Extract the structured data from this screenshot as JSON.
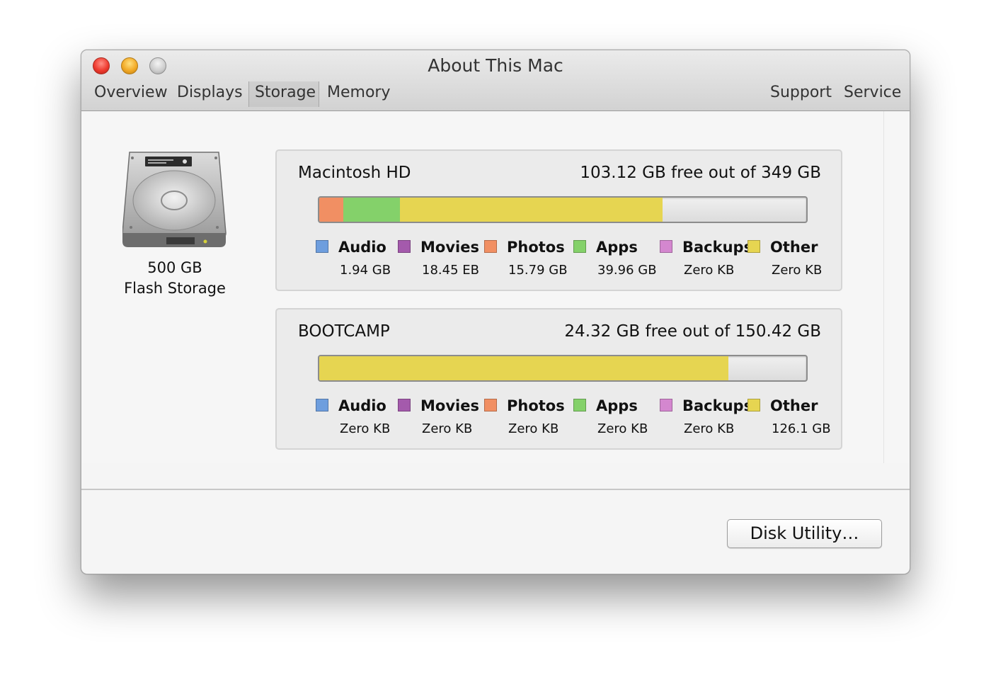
{
  "window": {
    "title": "About This Mac",
    "tabs_left": [
      "Overview",
      "Displays",
      "Storage",
      "Memory"
    ],
    "tabs_right": [
      "Support",
      "Service"
    ],
    "selected_tab": "Storage"
  },
  "device": {
    "capacity": "500 GB",
    "type": "Flash Storage"
  },
  "volumes": [
    {
      "name": "Macintosh HD",
      "free_text": "103.12 GB free out of 349 GB",
      "segments": [
        {
          "category": "Photos",
          "fraction": 0.05,
          "color": "#f18f63"
        },
        {
          "category": "Apps",
          "fraction": 0.115,
          "color": "#84d16a"
        },
        {
          "category": "Other",
          "fraction": 0.54,
          "color": "#e6d551"
        }
      ],
      "legend": [
        {
          "label": "Audio",
          "value": "1.94 GB",
          "color": "#6e9ede"
        },
        {
          "label": "Movies",
          "value": "18.45 EB",
          "color": "#a45aac"
        },
        {
          "label": "Photos",
          "value": "15.79 GB",
          "color": "#f18f63"
        },
        {
          "label": "Apps",
          "value": "39.96 GB",
          "color": "#84d16a"
        },
        {
          "label": "Backups",
          "value": "Zero KB",
          "color": "#d487cf"
        },
        {
          "label": "Other",
          "value": "Zero KB",
          "color": "#e6d551"
        }
      ]
    },
    {
      "name": "BOOTCAMP",
      "free_text": "24.32 GB free out of 150.42 GB",
      "segments": [
        {
          "category": "Other",
          "fraction": 0.84,
          "color": "#e6d551"
        }
      ],
      "legend": [
        {
          "label": "Audio",
          "value": "Zero KB",
          "color": "#6e9ede"
        },
        {
          "label": "Movies",
          "value": "Zero KB",
          "color": "#a45aac"
        },
        {
          "label": "Photos",
          "value": "Zero KB",
          "color": "#f18f63"
        },
        {
          "label": "Apps",
          "value": "Zero KB",
          "color": "#84d16a"
        },
        {
          "label": "Backups",
          "value": "Zero KB",
          "color": "#d487cf"
        },
        {
          "label": "Other",
          "value": "126.1 GB",
          "color": "#e6d551"
        }
      ]
    }
  ],
  "footer": {
    "disk_utility_label": "Disk Utility…"
  }
}
